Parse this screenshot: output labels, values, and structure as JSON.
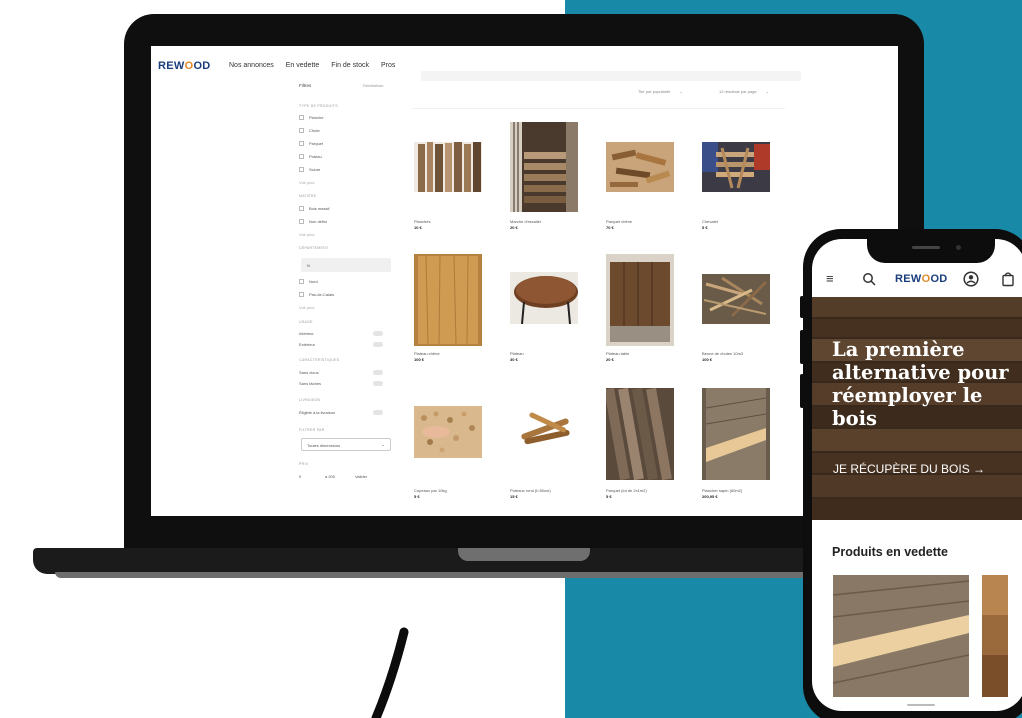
{
  "laptop_site": {
    "logo": "REWOOD",
    "nav": [
      "Nos annonces",
      "En vedette",
      "Fin de stock",
      "Pros"
    ],
    "sidebar": {
      "filters_label": "Filtres",
      "reset_label": "Réinitialiser",
      "type_heading": "TYPE DE PRODUITS",
      "types": [
        "Planche",
        "Chute",
        "Parquet",
        "Poteau",
        "Sciure"
      ],
      "see_more_1": "Voir plus",
      "matter_heading": "MATIÈRE",
      "matters": [
        "Bois massif",
        "Non défini"
      ],
      "see_more_2": "Voir plus",
      "dept_heading": "DÉPARTEMENT",
      "dept_input": "N",
      "depts": [
        "Nord",
        "Pas-de-Calais"
      ],
      "see_more_3": "Voir plus",
      "usage_heading": "USAGE",
      "usages": [
        "Intérieur",
        "Extérieur"
      ],
      "char_heading": "CARACTÉRISTIQUES",
      "chars": [
        "Sans clous",
        "Sans tâches"
      ],
      "delivery_heading": "LIVRAISON",
      "delivery": "Éligible à la livraison",
      "filter_by_heading": "FILTRER PAR",
      "dimension_select": "Toutes dimensions",
      "price_heading": "PRIX",
      "price_from": "0",
      "price_to": "à 200",
      "validate": "Valider"
    },
    "sort": {
      "sort_by": "Tier par popularité",
      "per_page": "12 résultats par page"
    },
    "products": [
      {
        "name": "Planches",
        "price": "10 €"
      },
      {
        "name": "Marche d'escalier",
        "price": "20 €"
      },
      {
        "name": "Parquet chêne",
        "price": "70 €"
      },
      {
        "name": "Chevalet",
        "price": "5 €"
      },
      {
        "name": "Plateau chêne",
        "price": "100 €"
      },
      {
        "name": "Plateau",
        "price": "30 €"
      },
      {
        "name": "Plateau table",
        "price": "20 €"
      },
      {
        "name": "Benne de chutes 10m3",
        "price": "100 €"
      },
      {
        "name": "Copeaux par 10kg",
        "price": "5 €"
      },
      {
        "name": "Poteaux rond (h.50cm)",
        "price": "15 €"
      },
      {
        "name": "Parquet (lot de 2x1m2)",
        "price": "5 €"
      },
      {
        "name": "Plancher sapin (60m2)",
        "price": "200,95 €"
      }
    ]
  },
  "mobile_site": {
    "logo": "REWOOD",
    "icons": [
      "menu-icon",
      "search-icon",
      "account-icon",
      "bag-icon"
    ],
    "hero_title": "La première alternative pour réemployer le bois",
    "hero_cta": "JE RÉCUPÈRE DU BOIS →",
    "featured_heading": "Produits en vedette"
  },
  "colors": {
    "teal": "#1889a6",
    "brand_blue": "#1a3d7c",
    "logo_accent": "#e08a2c"
  }
}
